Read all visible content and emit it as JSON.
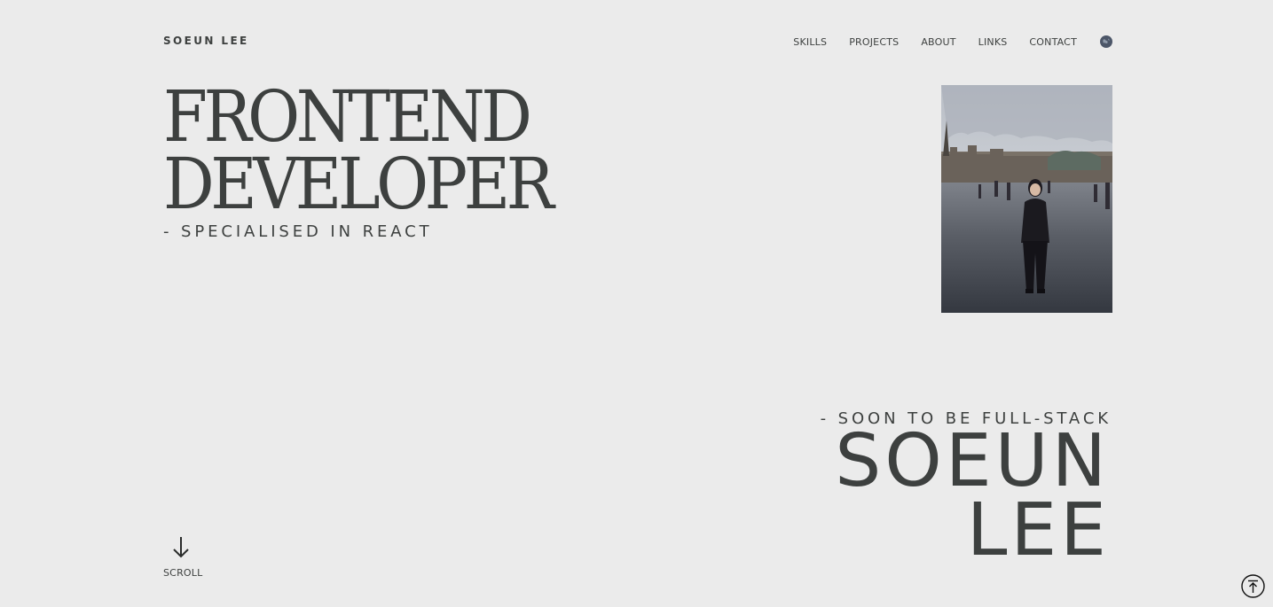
{
  "header": {
    "logo": "SOEUN LEE",
    "nav": [
      {
        "label": "SKILLS"
      },
      {
        "label": "PROJECTS"
      },
      {
        "label": "ABOUT"
      },
      {
        "label": "LINKS"
      },
      {
        "label": "CONTACT"
      }
    ],
    "language_icon": "globe-icon"
  },
  "hero": {
    "title_line1": "FRONTEND",
    "title_line2": "DEVELOPER",
    "subtitle": "- SPECIALISED IN REACT",
    "photo_icon": "profile-photo"
  },
  "intro": {
    "subtitle": "- SOON TO BE FULL-STACK",
    "name_line1": "SOEUN",
    "name_line2": "LEE"
  },
  "scroll": {
    "label": "SCROLL",
    "icon": "arrow-down-icon"
  },
  "back_to_top": {
    "icon": "arrow-up-circle-icon"
  },
  "colors": {
    "background": "#ebebeb",
    "text": "#3d403f",
    "globe": "#4c5668"
  }
}
